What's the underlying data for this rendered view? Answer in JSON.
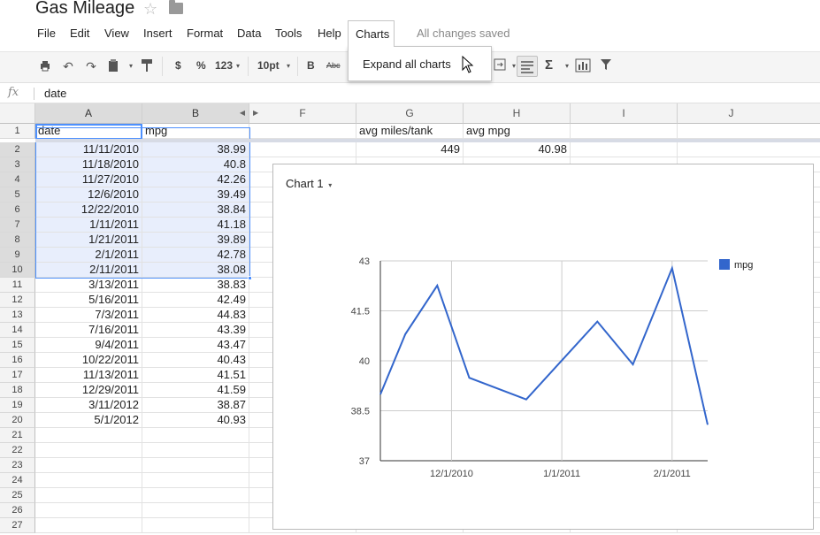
{
  "doc": {
    "title": "Gas Mileage",
    "save_status": "All changes saved"
  },
  "menu": [
    "File",
    "Edit",
    "View",
    "Insert",
    "Format",
    "Data",
    "Tools",
    "Help",
    "Charts"
  ],
  "charts_menu": {
    "items": [
      "Expand all charts"
    ]
  },
  "toolbar": {
    "currency": "$",
    "percent": "%",
    "number_format": "123",
    "font_size": "10pt",
    "bold": "B",
    "strikethrough": "Abc",
    "sum": "Σ"
  },
  "formula_bar": {
    "fx": "fx",
    "value": "date"
  },
  "columns": [
    "A",
    "B",
    "F",
    "G",
    "H",
    "I",
    "J"
  ],
  "rows": {
    "numbers": [
      "1",
      "2",
      "3",
      "4",
      "5",
      "6",
      "7",
      "8",
      "9",
      "10",
      "11",
      "12",
      "13",
      "14",
      "15",
      "16",
      "17",
      "18",
      "19",
      "20",
      "21",
      "22",
      "23",
      "24",
      "25",
      "26",
      "27"
    ],
    "header": {
      "a": "date",
      "b": "mpg",
      "g": "avg miles/tank",
      "h": "avg mpg"
    },
    "summary": {
      "g": "449",
      "h": "40.98"
    },
    "data": [
      {
        "date": "11/11/2010",
        "mpg": "38.99"
      },
      {
        "date": "11/18/2010",
        "mpg": "40.8"
      },
      {
        "date": "11/27/2010",
        "mpg": "42.26"
      },
      {
        "date": "12/6/2010",
        "mpg": "39.49"
      },
      {
        "date": "12/22/2010",
        "mpg": "38.84"
      },
      {
        "date": "1/11/2011",
        "mpg": "41.18"
      },
      {
        "date": "1/21/2011",
        "mpg": "39.89"
      },
      {
        "date": "2/1/2011",
        "mpg": "42.78"
      },
      {
        "date": "2/11/2011",
        "mpg": "38.08"
      },
      {
        "date": "3/13/2011",
        "mpg": "38.83"
      },
      {
        "date": "5/16/2011",
        "mpg": "42.49"
      },
      {
        "date": "7/3/2011",
        "mpg": "44.83"
      },
      {
        "date": "7/16/2011",
        "mpg": "43.39"
      },
      {
        "date": "9/4/2011",
        "mpg": "43.47"
      },
      {
        "date": "10/22/2011",
        "mpg": "40.43"
      },
      {
        "date": "11/13/2011",
        "mpg": "41.51"
      },
      {
        "date": "12/29/2011",
        "mpg": "41.59"
      },
      {
        "date": "3/11/2012",
        "mpg": "38.87"
      },
      {
        "date": "5/1/2012",
        "mpg": "40.93"
      }
    ]
  },
  "chart_title": "Chart 1",
  "chart_data": {
    "type": "line",
    "x": [
      "11/11/2010",
      "11/18/2010",
      "11/27/2010",
      "12/6/2010",
      "12/22/2010",
      "1/11/2011",
      "1/21/2011",
      "2/1/2011",
      "2/11/2011"
    ],
    "series": [
      {
        "name": "mpg",
        "values": [
          38.99,
          40.8,
          42.26,
          39.49,
          38.84,
          41.18,
          39.89,
          42.78,
          38.08
        ],
        "color": "#3366cc"
      }
    ],
    "x_ticks": [
      "12/1/2010",
      "1/1/2011",
      "2/1/2011"
    ],
    "y_ticks": [
      "37",
      "38.5",
      "40",
      "41.5",
      "43"
    ],
    "ylim": [
      37,
      43
    ],
    "xlim": [
      "11/11/2010",
      "2/11/2011"
    ],
    "grid": true,
    "legend": "right"
  }
}
